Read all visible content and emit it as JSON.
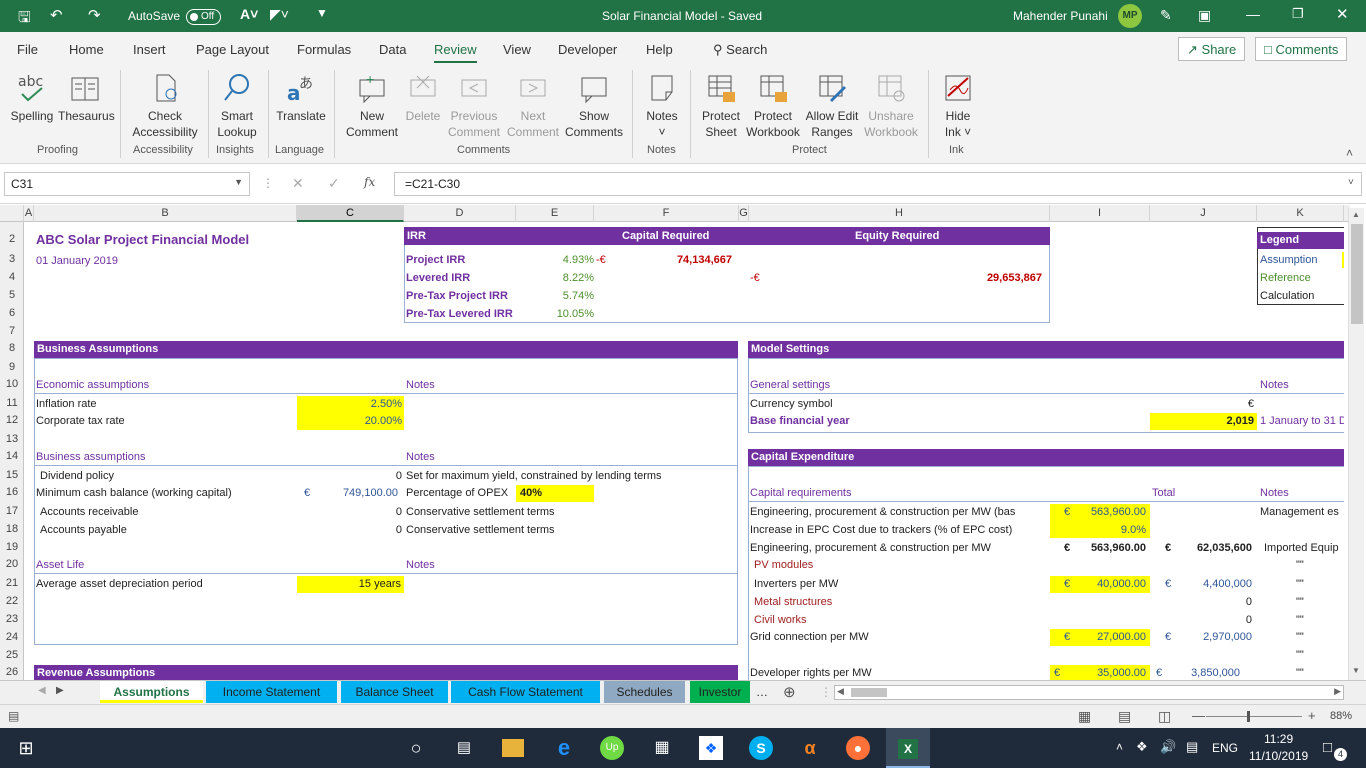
{
  "titlebar": {
    "autosave_label": "AutoSave",
    "autosave_state": "Off",
    "title": "Solar Financial Model  -  Saved",
    "user_name": "Mahender Punahi",
    "user_initials": "MP"
  },
  "tabs": [
    "File",
    "Home",
    "Insert",
    "Page Layout",
    "Formulas",
    "Data",
    "Review",
    "View",
    "Developer",
    "Help"
  ],
  "active_tab": "Review",
  "search_label": "Search",
  "share_label": "Share",
  "comments_label": "Comments",
  "ribbon": {
    "spelling": "Spelling",
    "thesaurus": "Thesaurus",
    "check_accessibility": [
      "Check",
      "Accessibility"
    ],
    "smart_lookup": [
      "Smart",
      "Lookup"
    ],
    "translate": "Translate",
    "new_comment": [
      "New",
      "Comment"
    ],
    "delete": "Delete",
    "previous_comment": [
      "Previous",
      "Comment"
    ],
    "next_comment": [
      "Next",
      "Comment"
    ],
    "show_comments": [
      "Show",
      "Comments"
    ],
    "notes": "Notes",
    "protect_sheet": [
      "Protect",
      "Sheet"
    ],
    "protect_workbook": [
      "Protect",
      "Workbook"
    ],
    "allow_edit_ranges": [
      "Allow Edit",
      "Ranges"
    ],
    "unshare_workbook": [
      "Unshare",
      "Workbook"
    ],
    "hide_ink": [
      "Hide",
      "Ink"
    ],
    "groups": [
      "Proofing",
      "Accessibility",
      "Insights",
      "Language",
      "Comments",
      "Notes",
      "Protect",
      "Ink"
    ]
  },
  "formula_bar": {
    "name_box": "C31",
    "formula": "=C21-C30",
    "fx": "fx"
  },
  "columns": [
    "A",
    "B",
    "C",
    "D",
    "E",
    "F",
    "G",
    "H",
    "I",
    "J",
    "K"
  ],
  "rows": [
    "2",
    "3",
    "4",
    "5",
    "6",
    "7",
    "8",
    "9",
    "10",
    "11",
    "12",
    "13",
    "14",
    "15",
    "16",
    "17",
    "18",
    "19",
    "20",
    "21",
    "22",
    "23",
    "24",
    "25",
    "26"
  ],
  "sheet": {
    "title": "ABC Solar Project Financial Model",
    "date": "01 January 2019",
    "irr_header": "IRR",
    "capital_required_header": "Capital Required",
    "equity_required_header": "Equity Required",
    "project_irr_label": "Project IRR",
    "project_irr": "4.93%",
    "project_irr_sym": "-€",
    "capital_required": "74,134,667",
    "levered_irr_label": "Levered IRR",
    "levered_irr": "8.22%",
    "equity_sym": "-€",
    "equity_required": "29,653,867",
    "pretax_project_irr_label": "Pre-Tax Project IRR",
    "pretax_project_irr": "5.74%",
    "pretax_levered_irr_label": "Pre-Tax Levered IRR",
    "pretax_levered_irr": "10.05%",
    "legend_header": "Legend",
    "legend_assumption": "Assumption",
    "legend_reference": "Reference",
    "legend_calculation": "Calculation",
    "business_assumptions": "Business Assumptions",
    "economic_assumptions": "Economic assumptions",
    "notes": "Notes",
    "inflation_rate_label": "Inflation rate",
    "inflation_rate": "2.50%",
    "corporate_tax_label": "Corporate tax rate",
    "corporate_tax": "20.00%",
    "business_assumptions_sub": "Business assumptions",
    "dividend_policy_label": "Dividend policy",
    "dividend_policy": "0",
    "dividend_note": "Set for maximum yield, constrained by lending terms",
    "min_cash_label": "Minimum cash balance (working capital)",
    "min_cash_sym": "€",
    "min_cash": "749,100.00",
    "min_cash_note": "Percentage of OPEX",
    "min_cash_pct": "40%",
    "ar_label": "Accounts receivable",
    "ar_value": "0",
    "ar_note": "Conservative settlement terms",
    "ap_label": "Accounts payable",
    "ap_value": "0",
    "ap_note": "Conservative settlement terms",
    "asset_life": "Asset Life",
    "avg_dep_label": "Average asset depreciation period",
    "avg_dep": "15 years",
    "revenue_assumptions": "Revenue Assumptions",
    "model_settings": "Model Settings",
    "general_settings": "General settings",
    "currency_symbol_label": "Currency symbol",
    "currency_symbol": "€",
    "base_year_label": "Base financial year",
    "base_year": "2,019",
    "base_year_note": "1 January to 31 D",
    "capex": "Capital Expenditure",
    "capital_requirements": "Capital requirements",
    "total": "Total",
    "epc_per_mw_bas_label": "Engineering, procurement & construction per MW (bas",
    "epc_per_mw_bas": "563,960.00",
    "epc_note": "Management es",
    "trackers_label": "Increase in EPC Cost due to trackers (% of EPC cost)",
    "trackers": "9.0%",
    "epc_per_mw_label": "Engineering, procurement & construction per MW",
    "epc_per_mw": "563,960.00",
    "epc_total": "62,035,600",
    "epc_total_note": "Imported Equip",
    "pv_modules": "PV modules",
    "inverters_label": "Inverters per MW",
    "inverters": "40,000.00",
    "inverters_total": "4,400,000",
    "metal_structures": "Metal structures",
    "metal_total": "0",
    "civil_works": "Civil works",
    "civil_total": "0",
    "grid_label": "Grid connection per MW",
    "grid": "27,000.00",
    "grid_total": "2,970,000",
    "dev_rights_label": "Developer rights per MW",
    "dev_rights": "35,000.00",
    "dev_rights_total": "3,850,000",
    "euro": "€",
    "ditto": "\"\""
  },
  "sheet_tabs": [
    "Assumptions",
    "Income Statement",
    "Balance Sheet",
    "Cash Flow Statement",
    "Schedules",
    "Investor"
  ],
  "sheet_tab_colors": [
    "#ffff00",
    "#00b0f0",
    "#00b0f0",
    "#00b0f0",
    "#8ea9c1",
    "#00b050"
  ],
  "status": {
    "zoom": "88%"
  },
  "taskbar": {
    "language": "ENG",
    "time": "11:29",
    "date": "11/10/2019",
    "notifications": "4"
  }
}
